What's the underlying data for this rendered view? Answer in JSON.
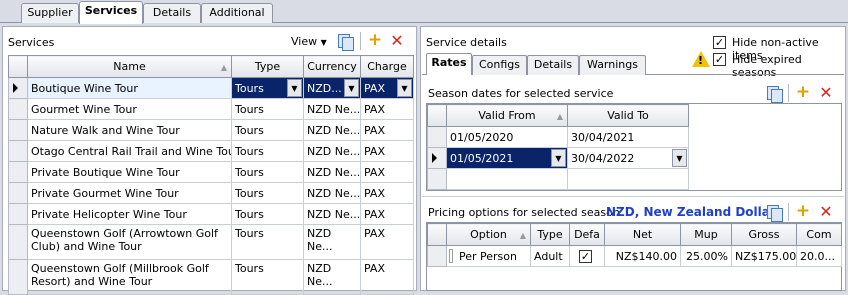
{
  "top_tabs": [
    "Supplier",
    "Services",
    "Details",
    "Additional"
  ],
  "services_panel": {
    "title": "Services",
    "view_label": "View",
    "columns": {
      "name": "Name",
      "type": "Type",
      "currency": "Currency",
      "charge": "Charge"
    },
    "rows": [
      {
        "name": "Boutique Wine Tour",
        "type": "Tours",
        "currency": "NZD...",
        "charge": "PAX"
      },
      {
        "name": "Gourmet Wine Tour",
        "type": "Tours",
        "currency": "NZD Ne...",
        "charge": "PAX"
      },
      {
        "name": "Nature Walk and Wine Tour",
        "type": "Tours",
        "currency": "NZD Ne...",
        "charge": "PAX"
      },
      {
        "name": "Otago Central Rail Trail and Wine Tour",
        "type": "Tours",
        "currency": "NZD Ne...",
        "charge": "PAX"
      },
      {
        "name": "Private Boutique Wine Tour",
        "type": "Tours",
        "currency": "NZD Ne...",
        "charge": "PAX"
      },
      {
        "name": "Private Gourmet Wine Tour",
        "type": "Tours",
        "currency": "NZD Ne...",
        "charge": "PAX"
      },
      {
        "name": "Private Helicopter Wine Tour",
        "type": "Tours",
        "currency": "NZD Ne...",
        "charge": "PAX"
      },
      {
        "name": "Queenstown Golf (Arrowtown Golf Club) and Wine Tour",
        "type": "Tours",
        "currency": "NZD Ne...",
        "charge": "PAX"
      },
      {
        "name": "Queenstown Golf (Millbrook Golf Resort) and Wine Tour",
        "type": "Tours",
        "currency": "NZD Ne...",
        "charge": "PAX"
      }
    ]
  },
  "service_details": {
    "title": "Service details",
    "hide_non_active": {
      "label": "Hide non-active items",
      "checked": true
    },
    "hide_expired": {
      "label": "Hide expired seasons",
      "checked": true
    },
    "tabs": [
      "Rates",
      "Configs",
      "Details",
      "Warnings"
    ],
    "seasons": {
      "title": "Season dates for selected service",
      "columns": {
        "from": "Valid From",
        "to": "Valid To"
      },
      "rows": [
        {
          "from": "01/05/2020",
          "to": "30/04/2021"
        },
        {
          "from": "01/05/2021",
          "to": "30/04/2022"
        }
      ]
    },
    "pricing": {
      "title": "Pricing options for selected season.",
      "currency": "NZD, New Zealand Dollar",
      "columns": {
        "option": "Option",
        "type": "Type",
        "default": "Defa",
        "net": "Net",
        "mup": "Mup",
        "gross": "Gross",
        "com": "Com"
      },
      "rows": [
        {
          "option": "Per Person",
          "type": "Adult",
          "default": "✓",
          "net": "NZ$140.00",
          "mup": "25.00%",
          "gross": "NZ$175.00",
          "com": "20.0..."
        }
      ]
    }
  },
  "colors": {
    "selection": "#0a246a",
    "currency_text": "#1f3fc9",
    "add": "#e0a000",
    "delete": "#d6281c"
  }
}
